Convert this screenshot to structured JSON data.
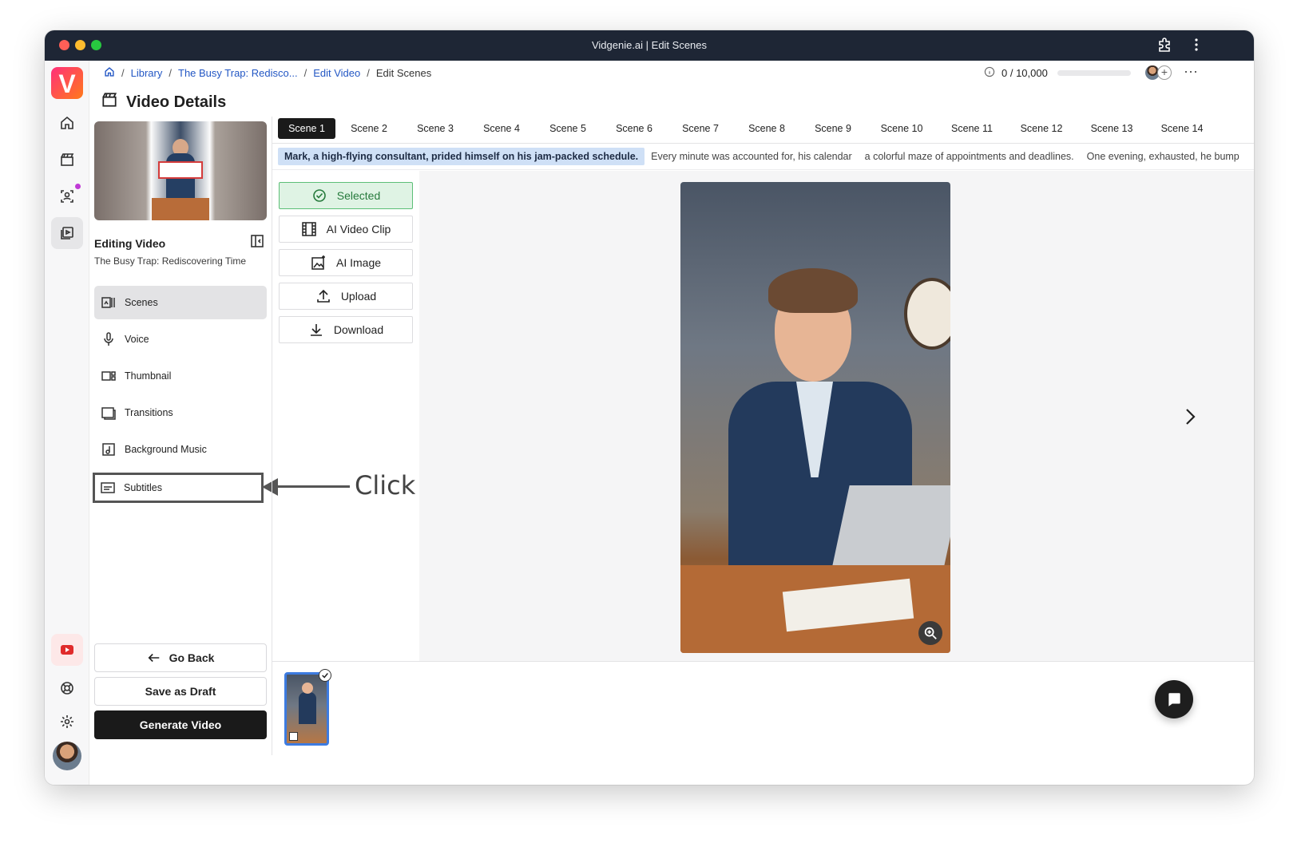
{
  "window": {
    "title": "Vidgenie.ai | Edit Scenes"
  },
  "logo": {
    "letter": "V"
  },
  "breadcrumb": {
    "items": [
      "Library",
      "The Busy Trap: Redisco...",
      "Edit Video"
    ],
    "current": "Edit Scenes",
    "separator": "/"
  },
  "credits": {
    "text": "0 / 10,000",
    "used_fraction": 0
  },
  "page": {
    "title": "Video Details"
  },
  "editing": {
    "title": "Editing Video",
    "subtitle": "The Busy Trap: Rediscovering Time"
  },
  "nav": {
    "items": [
      {
        "label": "Scenes",
        "icon": "scenes-icon",
        "active": true
      },
      {
        "label": "Voice",
        "icon": "microphone-icon"
      },
      {
        "label": "Thumbnail",
        "icon": "thumbnail-icon"
      },
      {
        "label": "Transitions",
        "icon": "transitions-icon"
      },
      {
        "label": "Background Music",
        "icon": "music-icon"
      },
      {
        "label": "Subtitles",
        "icon": "subtitles-icon",
        "highlighted": true
      }
    ]
  },
  "actions": {
    "go_back": "Go Back",
    "save_draft": "Save as Draft",
    "generate": "Generate Video"
  },
  "scenes": {
    "tabs": [
      "Scene 1",
      "Scene 2",
      "Scene 3",
      "Scene 4",
      "Scene 5",
      "Scene 6",
      "Scene 7",
      "Scene 8",
      "Scene 9",
      "Scene 10",
      "Scene 11",
      "Scene 12",
      "Scene 13",
      "Scene 14"
    ],
    "active_index": 0
  },
  "sentences": [
    "Mark, a high-flying consultant, prided himself on his jam-packed schedule.",
    "Every minute was accounted for, his calendar",
    "a colorful maze of appointments and deadlines.",
    "One evening, exhausted, he bump"
  ],
  "media_options": {
    "selected": "Selected",
    "ai_video_clip": "AI Video Clip",
    "ai_image": "AI Image",
    "upload": "Upload",
    "download": "Download"
  },
  "annotation": {
    "text": "Click here"
  },
  "colors": {
    "accent_blue": "#2357c4",
    "selected_green": "#267a3c",
    "titlebar": "#1e2635",
    "primary_button": "#1a1a1a"
  }
}
